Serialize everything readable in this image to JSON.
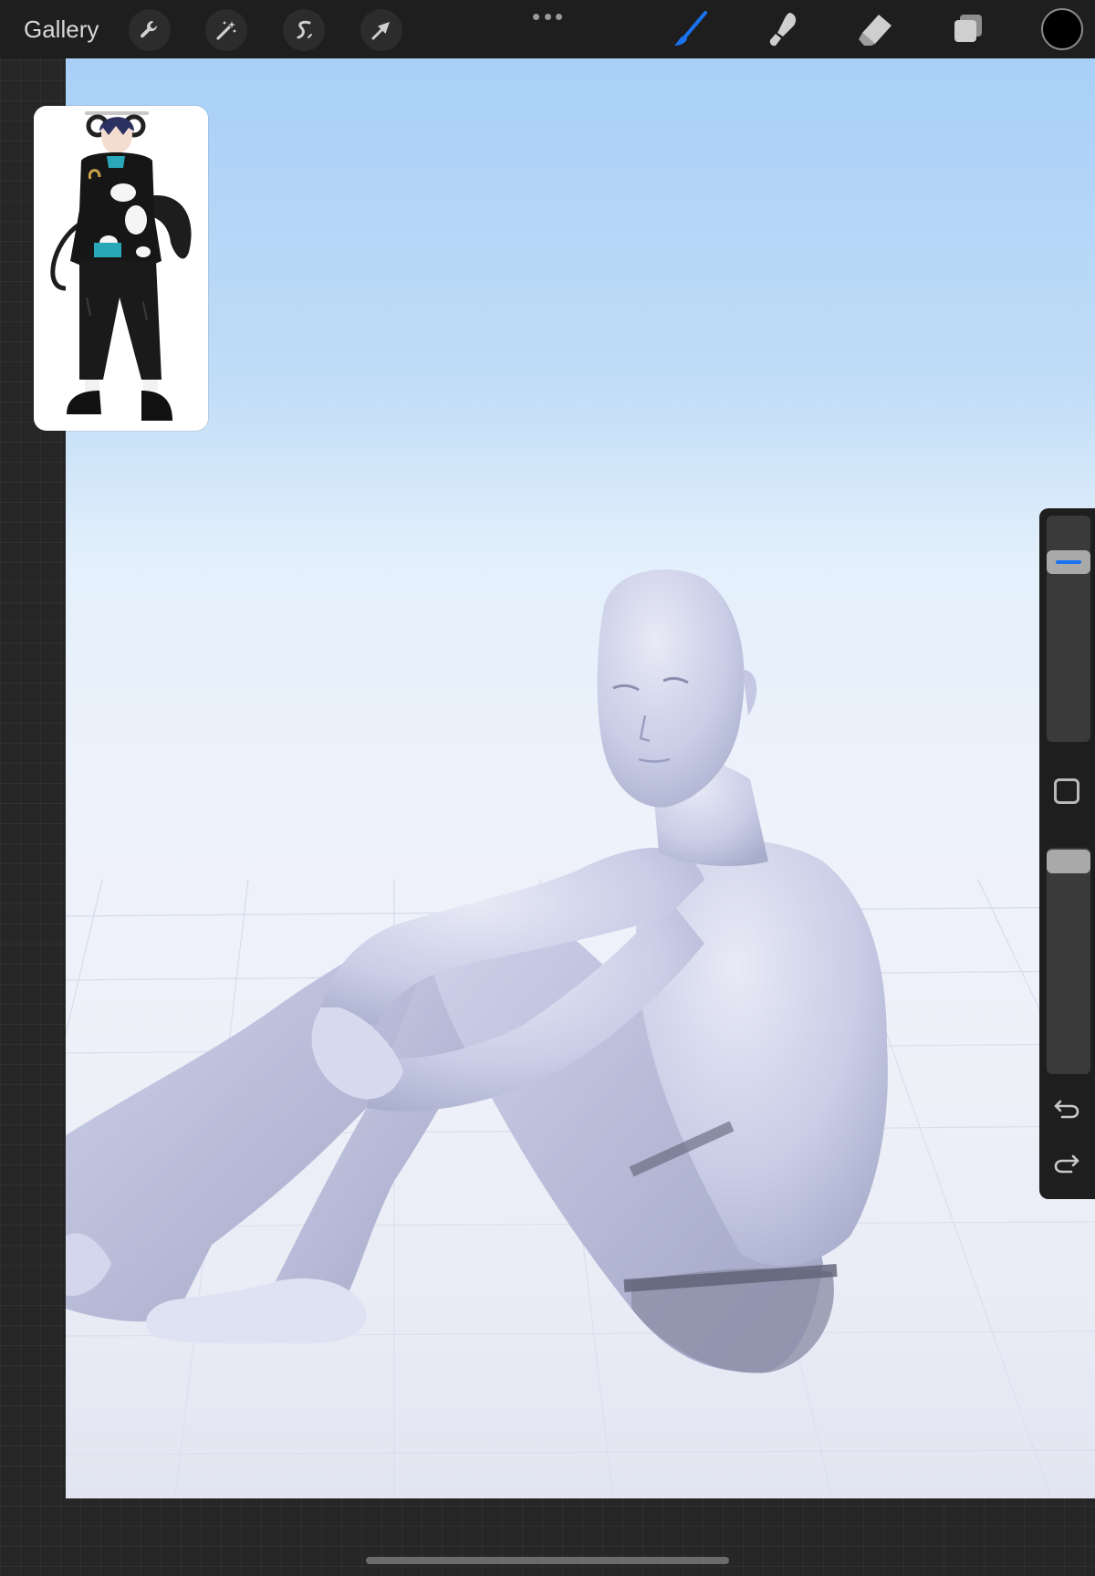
{
  "toolbar": {
    "gallery_label": "Gallery",
    "left_tools": [
      {
        "icon": "wrench-icon",
        "name": "actions"
      },
      {
        "icon": "magic-wand-icon",
        "name": "adjustments"
      },
      {
        "icon": "selection-s-icon",
        "name": "selection"
      },
      {
        "icon": "arrow-cursor-icon",
        "name": "transform"
      }
    ],
    "more_icon": "ellipsis-icon",
    "right_tools": [
      {
        "icon": "brush-icon",
        "name": "brush",
        "active": true
      },
      {
        "icon": "smudge-icon",
        "name": "smudge",
        "active": false
      },
      {
        "icon": "eraser-icon",
        "name": "eraser",
        "active": false
      },
      {
        "icon": "layers-icon",
        "name": "layers",
        "active": false
      }
    ],
    "current_color": "#000000"
  },
  "colors": {
    "app_background": "#262626",
    "toolbar_background": "#1e1e1e",
    "active_tool": "#1a73f0",
    "sky_top": "#a9d0f7",
    "floor": "#e6e8f4",
    "figure": "#c7cbe4"
  },
  "sidebar": {
    "brush_size_level": 0.11,
    "opacity_level": 0.0,
    "modify_icon": "square-icon",
    "undo_icon": "undo-icon",
    "redo_icon": "redo-icon"
  },
  "reference": {
    "description_icon": "character-reference-image"
  }
}
